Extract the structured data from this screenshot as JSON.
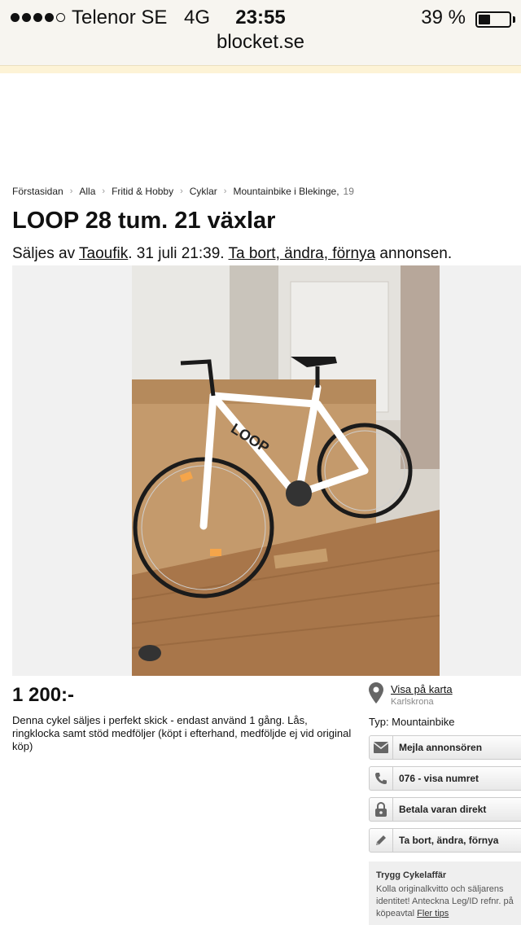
{
  "status_bar": {
    "carrier": "Telenor SE",
    "network": "4G",
    "time": "23:55",
    "battery_percent": "39 %",
    "battery_level": 0.39
  },
  "browser": {
    "url": "blocket.se"
  },
  "breadcrumb": {
    "items": [
      "Förstasidan",
      "Alla",
      "Fritid & Hobby",
      "Cyklar",
      "Mountainbike i Blekinge,"
    ],
    "count": "19"
  },
  "listing": {
    "title": "LOOP 28 tum. 21 växlar",
    "sold_by_prefix": "Säljes av",
    "seller": "Taoufik",
    "date_text": ". 31 juli 21:39.",
    "edit_link": "Ta bort, ändra, förnya",
    "edit_suffix": "annonsen.",
    "price": "1 200:-",
    "description": "Denna cykel säljes i perfekt skick - endast använd 1 gång. Lås, ringklocka samt stöd medföljer (köpt i efterhand, medföljde ej vid original köp)"
  },
  "sidebar": {
    "map_link": "Visa på karta",
    "location": "Karlskrona",
    "type_text": "Typ: Mountainbike",
    "actions": [
      {
        "label": "Mejla annonsören",
        "icon": "envelope-icon"
      },
      {
        "label": "076 - visa numret",
        "icon": "phone-icon"
      },
      {
        "label": "Betala varan direkt",
        "icon": "lock-icon"
      },
      {
        "label": "Ta bort, ändra, förnya",
        "icon": "pencil-icon"
      }
    ],
    "trygg": {
      "title": "Trygg Cykelaffär",
      "line1": "Kolla originalkvitto och säljarens",
      "line2": "identitet! Anteckna Leg/ID refnr. på",
      "line3": "köpeavtal",
      "link": "Fler tips"
    }
  },
  "colors": {
    "status_bg": "#f7f5f0",
    "accent_line": "#fdf3d6",
    "icon_gray": "#666666"
  }
}
